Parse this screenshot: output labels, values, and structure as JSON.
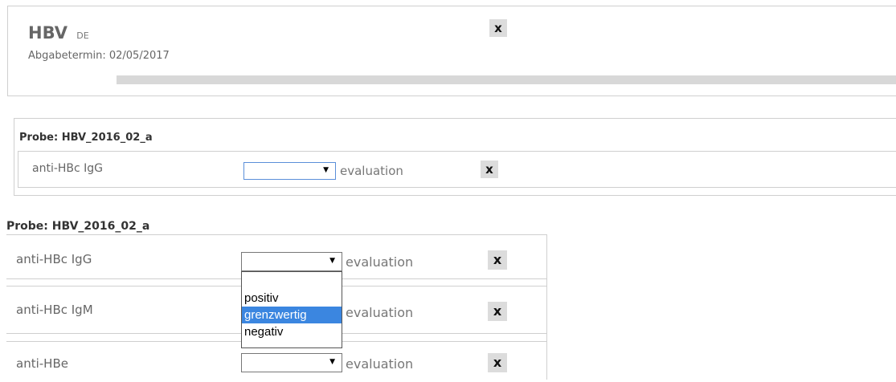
{
  "header": {
    "title": "HBV",
    "title_suffix": "DE",
    "deadline": "Abgabetermin: 02/05/2017",
    "close_label": "x"
  },
  "top_sample": {
    "title": "Probe: HBV_2016_02_a",
    "rows": [
      {
        "label": "anti-HBc IgG",
        "select_value": "",
        "eval_label": "evaluation",
        "remove_label": "x"
      }
    ]
  },
  "bottom_sample": {
    "title": "Probe: HBV_2016_02_a",
    "rows": [
      {
        "label": "anti-HBc IgG",
        "select_value": "",
        "eval_label": "evaluation",
        "remove_label": "x"
      },
      {
        "label": "anti-HBc IgM",
        "select_value": "",
        "eval_label": "evaluation",
        "remove_label": "x"
      },
      {
        "label": "anti-HBe",
        "select_value": "",
        "eval_label": "evaluation",
        "remove_label": "x"
      }
    ],
    "dropdown": {
      "options": [
        "",
        "positiv",
        "grenzwertig",
        "negativ"
      ],
      "highlighted": "grenzwertig"
    }
  },
  "colors": {
    "highlight": "#3b86e0",
    "button_bg": "#dcdcdc",
    "progress_bar": "#d8d8d8"
  }
}
